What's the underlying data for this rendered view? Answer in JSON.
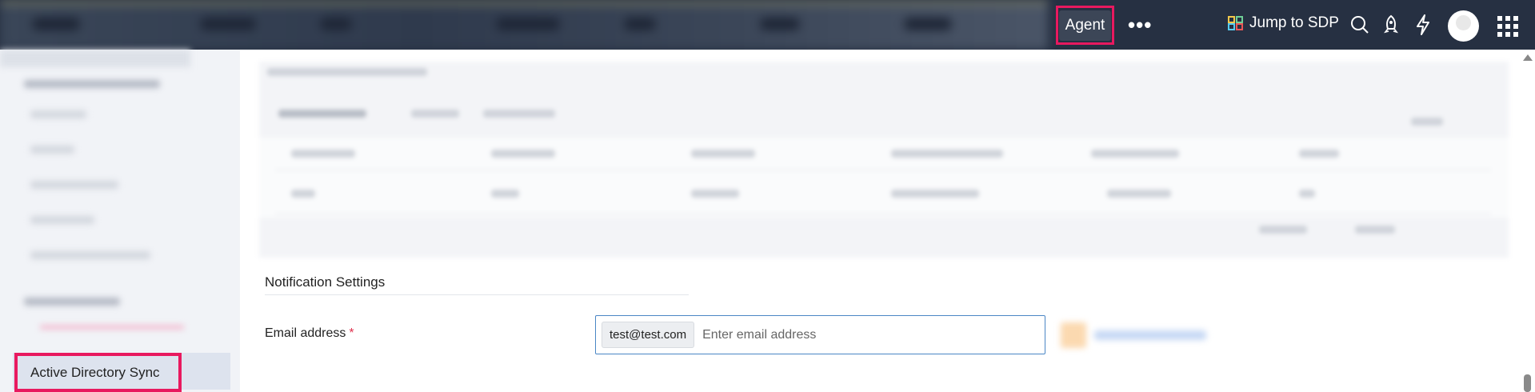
{
  "header": {
    "role_label": "Agent",
    "more_label": "•••",
    "jump_label": "Jump to SDP",
    "icons": [
      "search-icon",
      "rocket-icon",
      "lightning-icon",
      "avatar",
      "app-grid-icon"
    ],
    "highlight_color": "#e8195f"
  },
  "sidebar": {
    "active_item_label": "Active Directory Sync"
  },
  "notification": {
    "section_title": "Notification Settings",
    "email_label": "Email address",
    "required_mark": "*",
    "email_chip": "test@test.com",
    "email_placeholder": "Enter email address"
  },
  "colors": {
    "accent_highlight": "#e8195f",
    "topbar_bg": "#263042",
    "input_border": "#4a86c5",
    "required": "#e0334f"
  }
}
